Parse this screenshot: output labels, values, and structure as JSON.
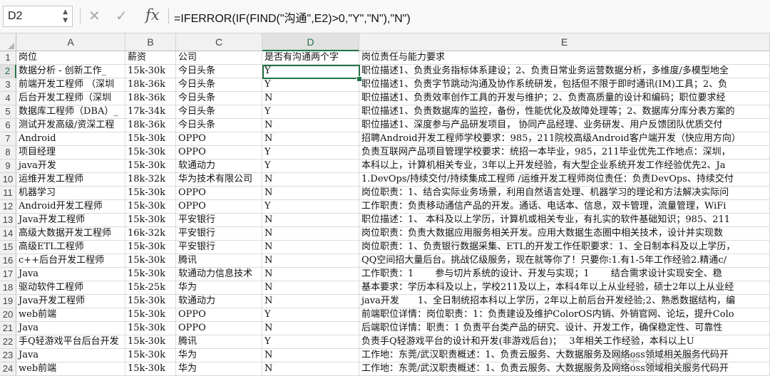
{
  "formula_bar": {
    "name_box": "D2",
    "cancel_icon": "✕",
    "enter_icon": "✓",
    "fx_label": "fx",
    "formula": "=IFERROR(IF(FIND(\"沟通\",E2)>0,\"Y\",\"N\"),\"N\")"
  },
  "columns": [
    "A",
    "B",
    "C",
    "D",
    "E"
  ],
  "selected_cell": "D2",
  "rows": [
    {
      "num": "1",
      "cells": [
        "岗位",
        "薪资",
        "公司",
        "是否有沟通两个字",
        "岗位责任与能力要求"
      ]
    },
    {
      "num": "2",
      "cells": [
        "数据分析 - 创新工作_",
        "15k-30k",
        "今日头条",
        "Y",
        "职位描述1、负责业务指标体系建设；2、负责日常业务运营数据分析，多维度/多模型地全"
      ]
    },
    {
      "num": "3",
      "cells": [
        "前端开发工程师 （深圳",
        "18k-36k",
        "今日头条",
        "Y",
        "职位描述1、负责字节跳动沟通及协作系统研发，包括但不限于即时通讯(IM)工具；2、负"
      ]
    },
    {
      "num": "4",
      "cells": [
        "后台开发工程师（深圳",
        "18k-36k",
        "今日头条",
        "N",
        "职位描述1、负责效率创作工具的开发与维护；2、负责高质量的设计和编码；职位要求经"
      ]
    },
    {
      "num": "5",
      "cells": [
        "数据库工程师（DBA）_",
        "17k-34k",
        "今日头条",
        "Y",
        "职位描述1、负责数据库的监控，备份，性能优化及故障处理等；2、数据库分库分表方案的"
      ]
    },
    {
      "num": "6",
      "cells": [
        "测试开发高级/资深工程",
        "18k-36k",
        "今日头条",
        "N",
        "职位描述1、深度参与产品研发项目， 协同产品经理、业务研发、用户反馈团队优质交付"
      ]
    },
    {
      "num": "7",
      "cells": [
        "Android",
        "15k-30k",
        "OPPO",
        "N",
        "招聘Android开发工程师学校要求：985，211院校高级Android客户端开发（快应用方向）"
      ]
    },
    {
      "num": "8",
      "cells": [
        "项目经理",
        "15k-30k",
        "OPPO",
        "Y",
        "负责互联网产品项目管理学校要求：统招一本毕业，985，211毕业优先工作地点：深圳，"
      ]
    },
    {
      "num": "9",
      "cells": [
        "java开发",
        "15k-30k",
        "软通动力",
        "Y",
        "本科以上，计算机相关专业，3年以上开发经验，有大型企业系统开发工作经验优先2、Ja"
      ]
    },
    {
      "num": "10",
      "cells": [
        "运维开发工程师",
        "18k-32k",
        "华为技术有限公司",
        "N",
        "1.DevOps/持续交付/持续集成工程师 /运维开发工程师岗位责任：负责DevOps、持续交付"
      ]
    },
    {
      "num": "11",
      "cells": [
        "机器学习",
        "15k-30k",
        "OPPO",
        "N",
        "岗位职责：1、结合实际业务场景，利用自然语言处理、机器学习的理论和方法解决实际问"
      ]
    },
    {
      "num": "12",
      "cells": [
        "Android开发工程师",
        "15k-30k",
        "OPPO",
        "Y",
        "工作职责：负责移动通信产品的开发。通话、电话本、信息，双卡管理，流量管理，WiFi"
      ]
    },
    {
      "num": "13",
      "cells": [
        "Java开发工程师",
        "15k-30k",
        "平安银行",
        "N",
        "职位描述：1、 本科及以上学历，计算机或相关专业，有扎实的软件基础知识；985、211"
      ]
    },
    {
      "num": "14",
      "cells": [
        "高级大数据开发工程师",
        "16k-32k",
        "平安银行",
        "N",
        "岗位职责：负责大数据应用服务相关开发。应用大数据生态圈中相关技术，设计并实现数"
      ]
    },
    {
      "num": "15",
      "cells": [
        "高级ETL工程师",
        "15k-30k",
        "平安银行",
        "N",
        "岗位职责：1、负责银行数据采集、ETL的开发工作任职要求：1、全日制本科及以上学历，"
      ]
    },
    {
      "num": "16",
      "cells": [
        "c++后台开发工程师",
        "15k-30k",
        "腾讯",
        "N",
        "QQ空间招大量后台。挑战亿级服务，现在就等你了！只要你:1.有1-5年工作经验2.精通c/"
      ]
    },
    {
      "num": "17",
      "cells": [
        "Java",
        "15k-30k",
        "软通动力信息技术",
        "N",
        "工作职责：1 　　参与切片系统的设计、开发与实现；1 　　结合需求设计实现安全、稳"
      ]
    },
    {
      "num": "18",
      "cells": [
        "驱动软件工程师",
        "15k-25k",
        "华为",
        "N",
        "基本要求：学历本科及以上，学校211及以上，本科4年以上从业经验，硕士2年以上从业经"
      ]
    },
    {
      "num": "19",
      "cells": [
        "Java开发工程师",
        "15k-30k",
        "软通动力",
        "N",
        "java开发　　1、全日制统招本科以上学历，2年以上前后台开发经验;2、熟悉数据结构，编"
      ]
    },
    {
      "num": "20",
      "cells": [
        "web前端",
        "15k-30k",
        "OPPO",
        "Y",
        "前端职位详情：岗位职责：1：负责建设及维护ColorOS内销、外销官网、论坛，提升Colo"
      ]
    },
    {
      "num": "21",
      "cells": [
        "Java",
        "15k-30k",
        "OPPO",
        "N",
        "后端职位详情：职责：1 负责平台类产品的研究、设计、开发工作，确保稳定性、可靠性"
      ]
    },
    {
      "num": "22",
      "cells": [
        "手Q轻游戏平台后台开发",
        "15k-30k",
        "腾讯",
        "Y",
        "负责手Q轻游戏平台的设计和开发(非游戏后台)；　 3年相关工作经验，本科以上U"
      ]
    },
    {
      "num": "23",
      "cells": [
        "Java",
        "15k-30k",
        "华为",
        "N",
        "工作地：东莞/武汉职责概述：1、负责云服务、大数据服务及网络oss领域相关服务代码开"
      ]
    },
    {
      "num": "24",
      "cells": [
        "web前端",
        "15k-30k",
        "华为",
        "N",
        "工作地：东莞/武汉职责概述：1、负责云服务、大数据服务及网络oss领域相关服务代码开"
      ]
    }
  ],
  "watermark": "知乎 @侯士卿"
}
